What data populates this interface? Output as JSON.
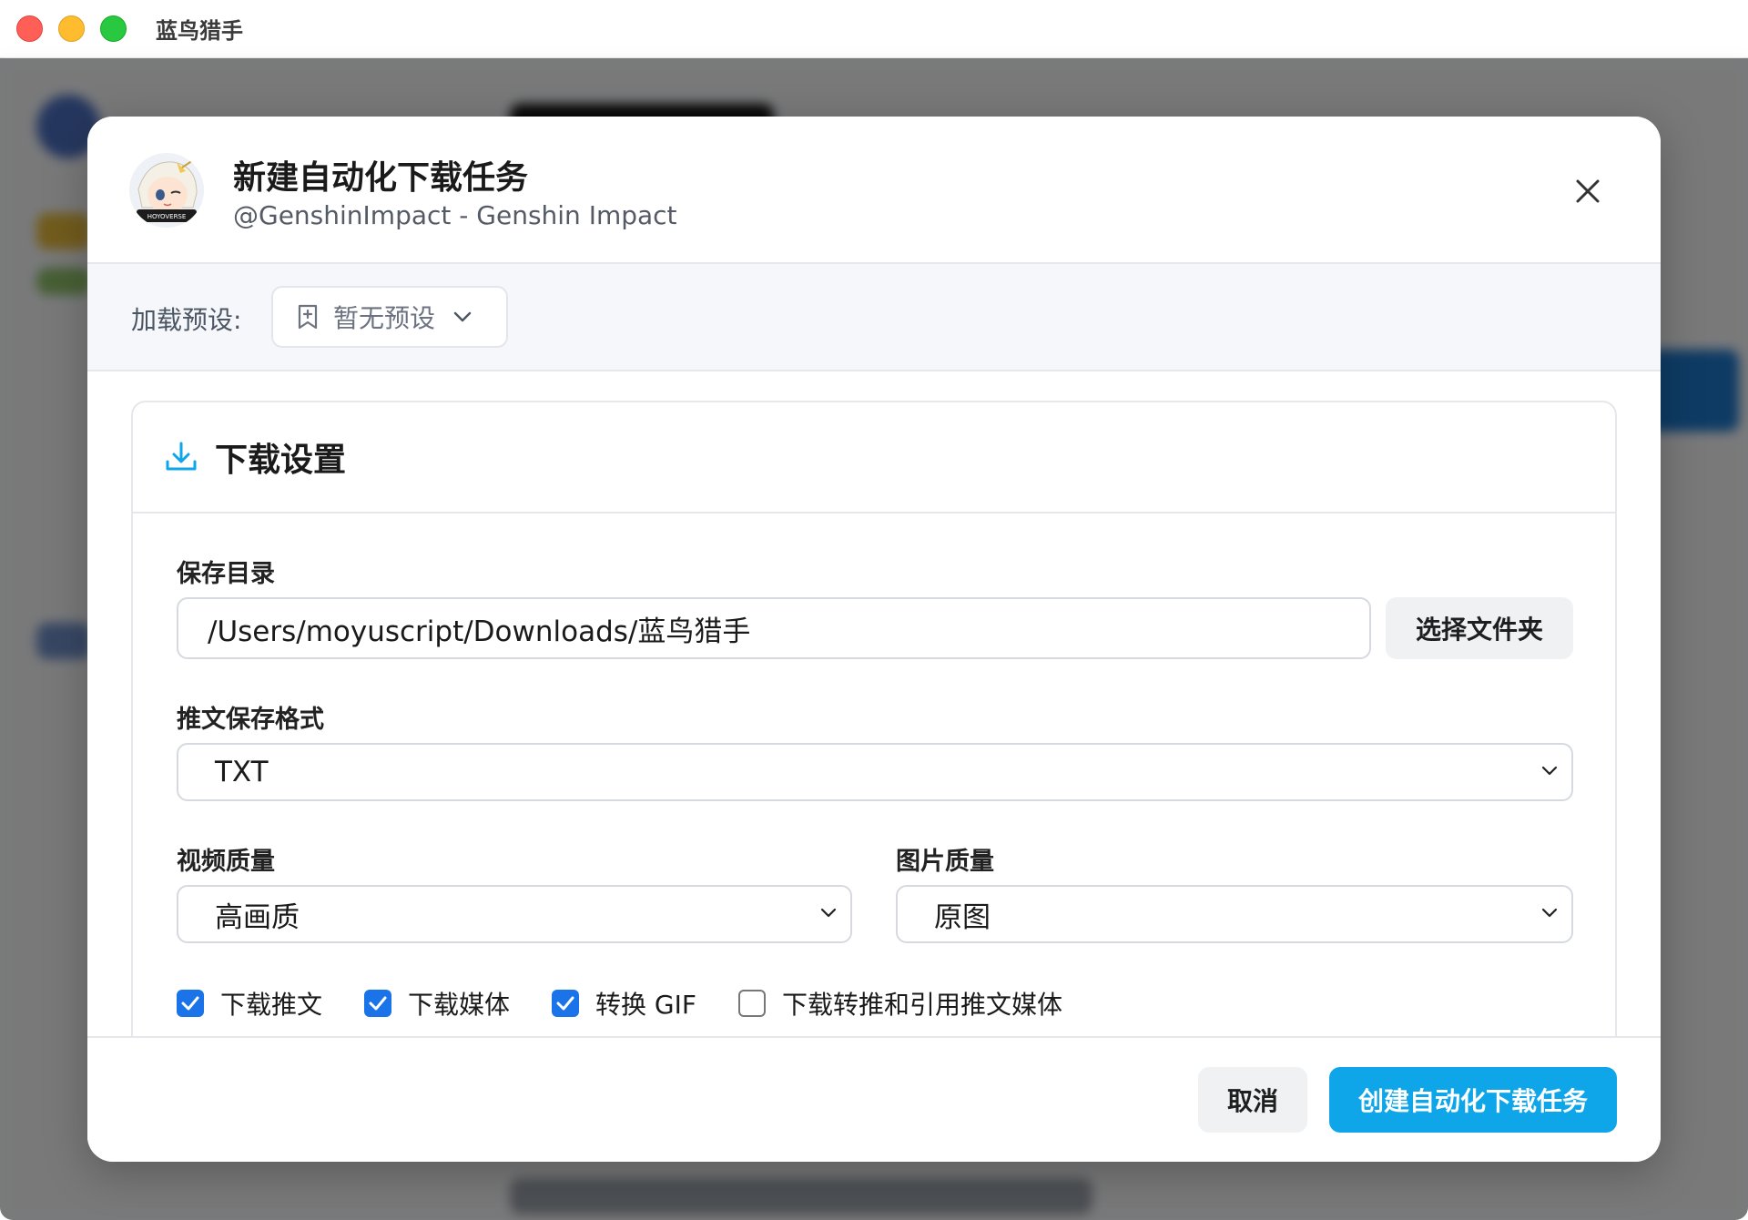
{
  "window": {
    "title": "蓝鸟猎手"
  },
  "modal": {
    "title": "新建自动化下载任务",
    "subtitle": "@GenshinImpact - Genshin Impact",
    "avatar_text": "HOYOVERSE"
  },
  "preset": {
    "label": "加载预设:",
    "value": "暂无预设"
  },
  "download_settings": {
    "title": "下载设置",
    "save_dir": {
      "label": "保存目录",
      "value": "/Users/moyuscript/Downloads/蓝鸟猎手",
      "button": "选择文件夹"
    },
    "tweet_format": {
      "label": "推文保存格式",
      "value": "TXT"
    },
    "video_quality": {
      "label": "视频质量",
      "value": "高画质"
    },
    "image_quality": {
      "label": "图片质量",
      "value": "原图"
    },
    "options": [
      {
        "label": "下载推文",
        "checked": true
      },
      {
        "label": "下载媒体",
        "checked": true
      },
      {
        "label": "转换 GIF",
        "checked": true
      },
      {
        "label": "下载转推和引用推文媒体",
        "checked": false
      }
    ]
  },
  "footer": {
    "cancel": "取消",
    "create": "创建自动化下载任务"
  },
  "colors": {
    "accent": "#0ea5e9",
    "checkbox": "#1a73e8",
    "icon_blue": "#0ea5e9"
  }
}
